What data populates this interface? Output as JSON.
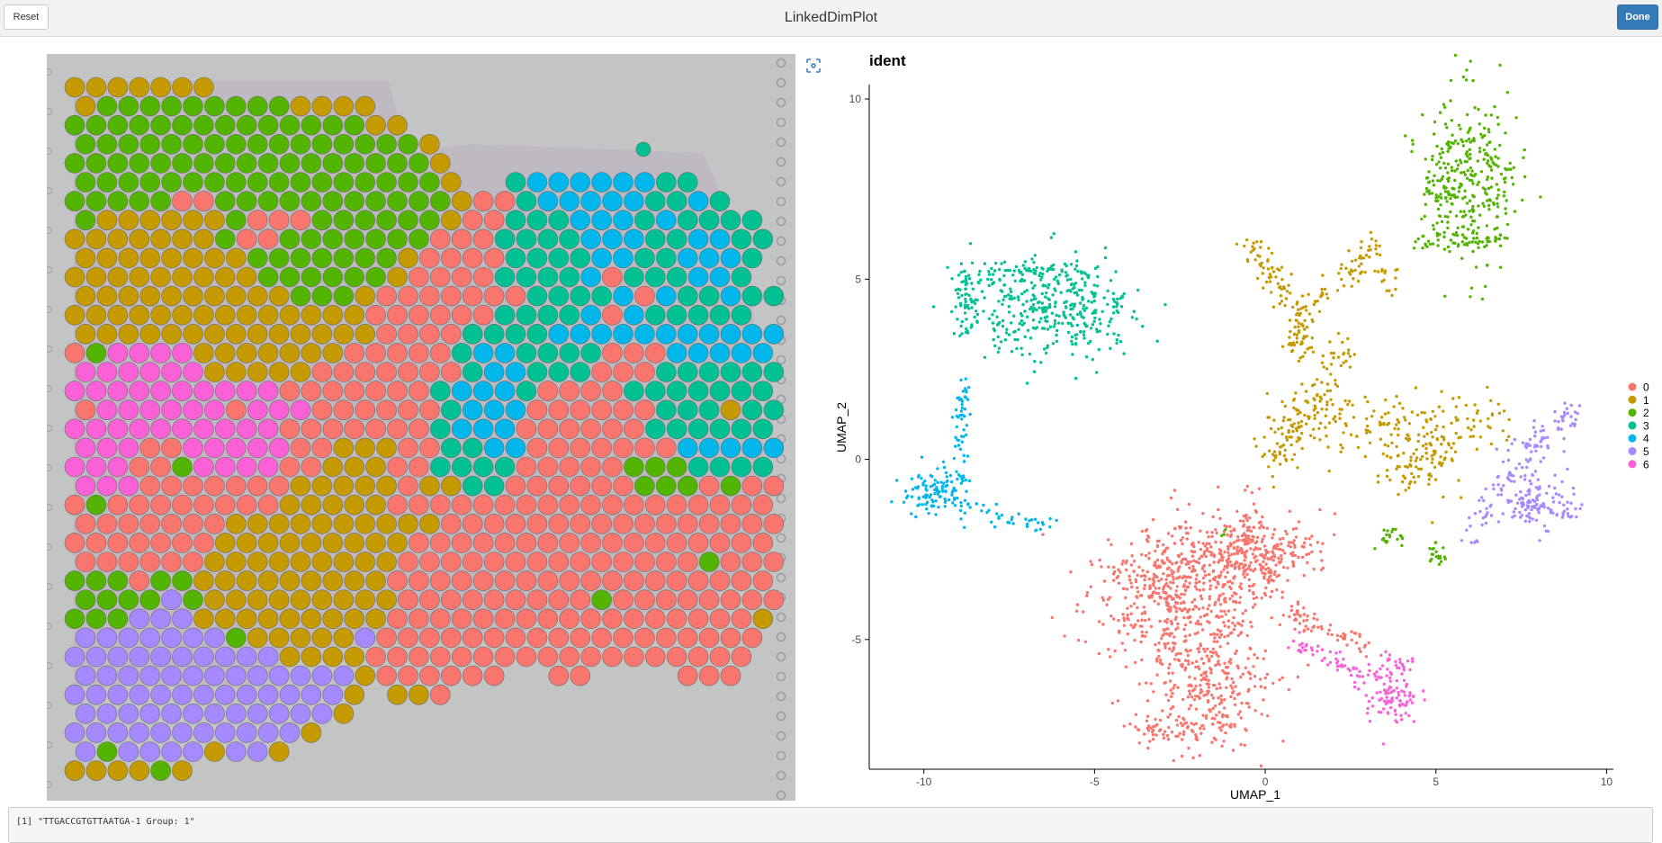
{
  "header": {
    "title": "LinkedDimPlot",
    "reset_label": "Reset",
    "done_label": "Done"
  },
  "console": {
    "output": "[1] \"TTGACCGTGTTAATGA-1 Group: 1\""
  },
  "colors": {
    "0": "#F8766D",
    "1": "#C49A00",
    "2": "#53B400",
    "3": "#00C094",
    "4": "#00B6EB",
    "5": "#A58AFF",
    "6": "#FB61D7",
    "accent": "#337ab7"
  },
  "spatial": {
    "rows": [
      "1111111",
      "12222222221111",
      "2222222222222211",
      "22222222222222221",
      "222222222222222221",
      "222222222222222221..344444433",
      "2222200222222222221003444443343",
      "21111112000222222100333444343333",
      "111111120022222220003333444334433",
      "11111111222222210000333344334443",
      "11111111122222210000333340333443",
      "111111111122210000000333340433433",
      "11111111111111000000333340433333",
      "111111111111110000333344444444444",
      "026666111111100000344333300044444",
      "666666111110000000344333000333333",
      "666666666600000003444300003333333",
      "066666606660000003444000000333133",
      "666666666600000003444000000333333",
      "666006666600111003344000000044444",
      "666002666600111003333000002223333",
      "666000000011111011330000002220200",
      "020000000011111000000000000000000",
      "000000011111111110000000000000000",
      "000000011111111100000000000000000",
      "000000111111111000000000000002000",
      "222022111111111000000000000000000",
      "222252111111111000000000200000000",
      "222555111111111000000000000000001",
      "55555552111115000000000000000000",
      "55555555551111000000000000000000",
      "55555555555551000000..00....000",
      "55555555555551.110",
      "5555555555551",
      "555555555551",
      "5255551551",
      "111121"
    ]
  },
  "chart_data": {
    "type": "scatter",
    "title": "ident",
    "xlabel": "UMAP_1",
    "ylabel": "UMAP_2",
    "xlim": [
      -11.6,
      10.2
    ],
    "ylim": [
      -8.6,
      10.4
    ],
    "xticks": [
      "-10",
      "-5",
      "0",
      "5",
      "10"
    ],
    "xtick_values": [
      -10,
      -5,
      0,
      5,
      10
    ],
    "yticks": [
      "-5",
      "0",
      "5",
      "10"
    ],
    "ytick_values": [
      -5,
      0,
      5,
      10
    ],
    "legend": {
      "placement": "right",
      "entries": [
        "0",
        "1",
        "2",
        "3",
        "4",
        "5",
        "6"
      ]
    },
    "grid": false,
    "clusters": [
      {
        "name": "0",
        "parts": [
          {
            "blob": [
              -2.5,
              -3.8
            ],
            "sd": [
              1.3,
              1.0
            ],
            "n": 520
          },
          {
            "blob": [
              -1.6,
              -6.3
            ],
            "sd": [
              0.9,
              0.9
            ],
            "n": 260
          },
          {
            "blob": [
              -0.4,
              -2.6
            ],
            "sd": [
              0.9,
              0.6
            ],
            "n": 200
          },
          {
            "line": [
              [
                -4.8,
                -3.2
              ],
              [
                1.6,
                -2.5
              ]
            ],
            "j": 0.25,
            "n": 120
          },
          {
            "line": [
              [
                0.6,
                -4.2
              ],
              [
                3.1,
                -5.2
              ]
            ],
            "j": 0.15,
            "n": 60
          },
          {
            "line": [
              [
                -3.8,
                -7.6
              ],
              [
                -1.2,
                -7.4
              ]
            ],
            "j": 0.2,
            "n": 70
          },
          {
            "line": [
              [
                -0.3,
                -1.0
              ],
              [
                -0.6,
                -3.0
              ]
            ],
            "j": 0.2,
            "n": 40
          }
        ]
      },
      {
        "name": "1",
        "parts": [
          {
            "line": [
              [
                -0.5,
                6.0
              ],
              [
                1.1,
                4.0
              ]
            ],
            "j": 0.2,
            "n": 70
          },
          {
            "line": [
              [
                1.1,
                4.0
              ],
              [
                3.3,
                5.9
              ]
            ],
            "j": 0.2,
            "n": 60
          },
          {
            "line": [
              [
                1.1,
                4.0
              ],
              [
                0.9,
                2.8
              ]
            ],
            "j": 0.2,
            "n": 50
          },
          {
            "line": [
              [
                0.15,
                -0.2
              ],
              [
                2.5,
                3.1
              ]
            ],
            "j": 0.3,
            "n": 110
          },
          {
            "line": [
              [
                0.6,
                1.0
              ],
              [
                6.8,
                1.0
              ]
            ],
            "j": 0.45,
            "n": 180
          },
          {
            "blob": [
              4.5,
              -0.1
            ],
            "sd": [
              0.6,
              0.5
            ],
            "n": 90
          },
          {
            "blob": [
              3.6,
              5.0
            ],
            "sd": [
              0.2,
              0.3
            ],
            "n": 15
          }
        ]
      },
      {
        "name": "2",
        "parts": [
          {
            "blob": [
              5.9,
              7.8
            ],
            "sd": [
              0.7,
              1.1
            ],
            "n": 330
          },
          {
            "line": [
              [
                4.3,
                6.0
              ],
              [
                7.0,
                6.1
              ]
            ],
            "j": 0.15,
            "n": 50
          },
          {
            "line": [
              [
                3.4,
                -2.3
              ],
              [
                4.0,
                -2.0
              ]
            ],
            "j": 0.12,
            "n": 20
          },
          {
            "line": [
              [
                5.0,
                -2.4
              ],
              [
                5.1,
                -3.0
              ]
            ],
            "j": 0.12,
            "n": 20
          },
          {
            "blob": [
              -1.2,
              -2.0
            ],
            "sd": [
              0.1,
              0.2
            ],
            "n": 3
          }
        ]
      },
      {
        "name": "3",
        "parts": [
          {
            "blob": [
              -6.3,
              4.2
            ],
            "sd": [
              1.2,
              0.7
            ],
            "n": 360
          },
          {
            "line": [
              [
                -8.8,
                5.4
              ],
              [
                -8.7,
                3.6
              ]
            ],
            "j": 0.2,
            "n": 60
          },
          {
            "line": [
              [
                -8.6,
                5.2
              ],
              [
                -5.0,
                5.2
              ]
            ],
            "j": 0.2,
            "n": 60
          }
        ]
      },
      {
        "name": "4",
        "parts": [
          {
            "line": [
              [
                -8.8,
                2.2
              ],
              [
                -9.0,
                -0.5
              ]
            ],
            "j": 0.12,
            "n": 50
          },
          {
            "blob": [
              -9.6,
              -0.9
            ],
            "sd": [
              0.5,
              0.35
            ],
            "n": 110
          },
          {
            "line": [
              [
                -9.2,
                -1.2
              ],
              [
                -6.2,
                -1.9
              ]
            ],
            "j": 0.15,
            "n": 40
          }
        ]
      },
      {
        "name": "5",
        "parts": [
          {
            "line": [
              [
                5.9,
                -2.2
              ],
              [
                7.4,
                0.1
              ]
            ],
            "j": 0.2,
            "n": 40
          },
          {
            "blob": [
              7.8,
              -1.0
            ],
            "sd": [
              0.5,
              0.5
            ],
            "n": 110
          },
          {
            "line": [
              [
                7.6,
                0.2
              ],
              [
                9.1,
                1.4
              ]
            ],
            "j": 0.25,
            "n": 60
          },
          {
            "line": [
              [
                7.8,
                -1.3
              ],
              [
                9.3,
                -1.5
              ]
            ],
            "j": 0.15,
            "n": 30
          }
        ]
      },
      {
        "name": "6",
        "parts": [
          {
            "line": [
              [
                0.9,
                -5.1
              ],
              [
                3.3,
                -6.2
              ]
            ],
            "j": 0.15,
            "n": 60
          },
          {
            "blob": [
              3.7,
              -6.6
            ],
            "sd": [
              0.4,
              0.4
            ],
            "n": 90
          },
          {
            "line": [
              [
                3.5,
                -5.5
              ],
              [
                4.3,
                -5.8
              ]
            ],
            "j": 0.15,
            "n": 20
          }
        ]
      }
    ]
  }
}
